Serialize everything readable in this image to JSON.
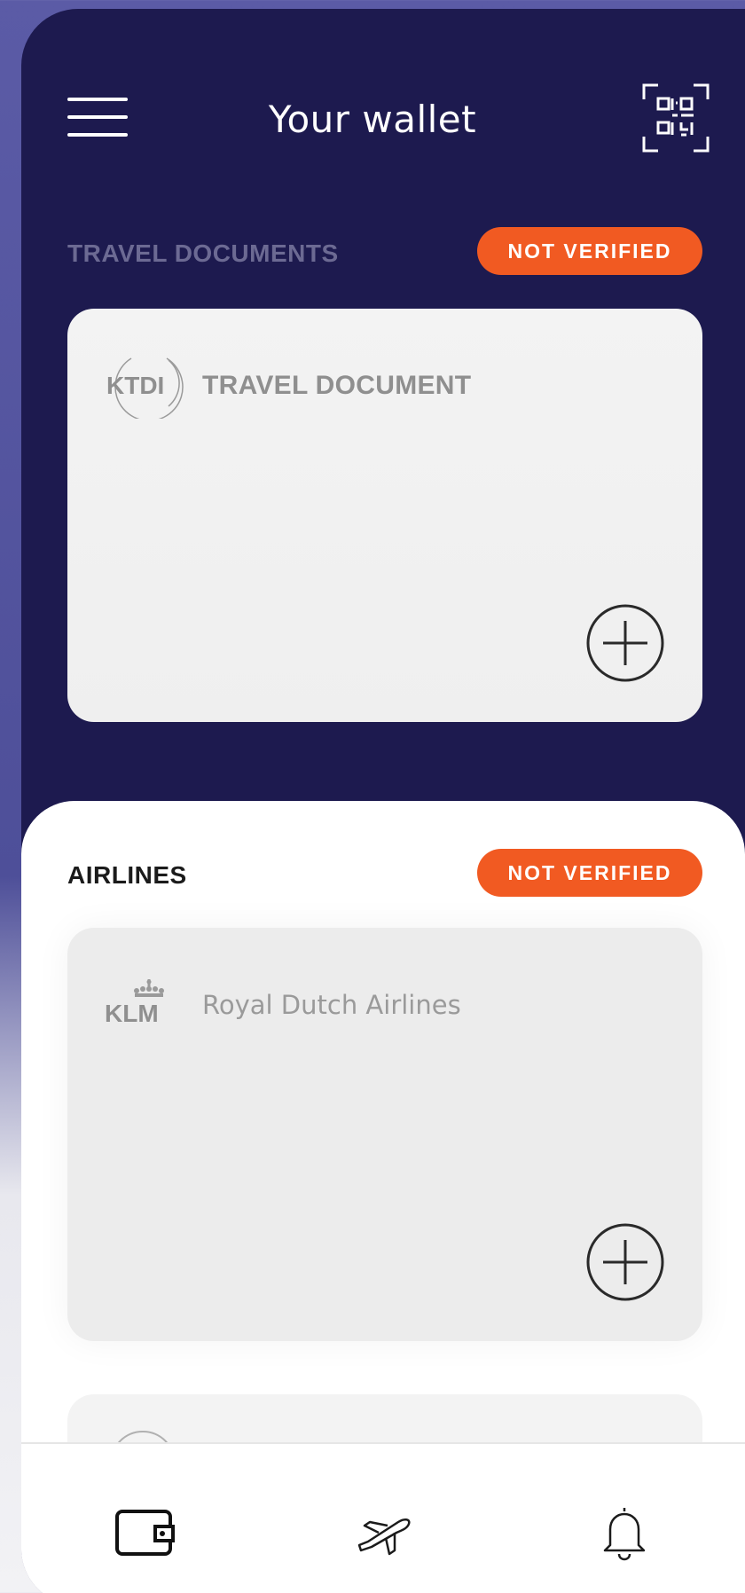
{
  "header": {
    "title": "Your wallet",
    "menu_icon": "hamburger-menu-icon",
    "qr_icon": "qr-scan-icon"
  },
  "travel_documents": {
    "section_label": "TRAVEL DOCUMENTS",
    "badge": "NOT VERIFIED",
    "card": {
      "logo_text": "KTDI",
      "title": "TRAVEL DOCUMENT",
      "add_icon": "plus-circle-icon"
    }
  },
  "airlines": {
    "section_label": "AIRLINES",
    "badge": "NOT VERIFIED",
    "card": {
      "logo_text": "KLM",
      "title": "Royal Dutch Airlines",
      "add_icon": "plus-circle-icon"
    }
  },
  "bottom_nav": {
    "items": [
      {
        "icon": "wallet-icon",
        "active": true
      },
      {
        "icon": "airplane-icon",
        "active": false
      },
      {
        "icon": "bell-icon",
        "active": false
      }
    ]
  },
  "colors": {
    "header_bg": "#1d1a4f",
    "badge": "#f15a22",
    "section_label_dark": "#6c6a93",
    "section_label_light": "#1b1b1b"
  }
}
